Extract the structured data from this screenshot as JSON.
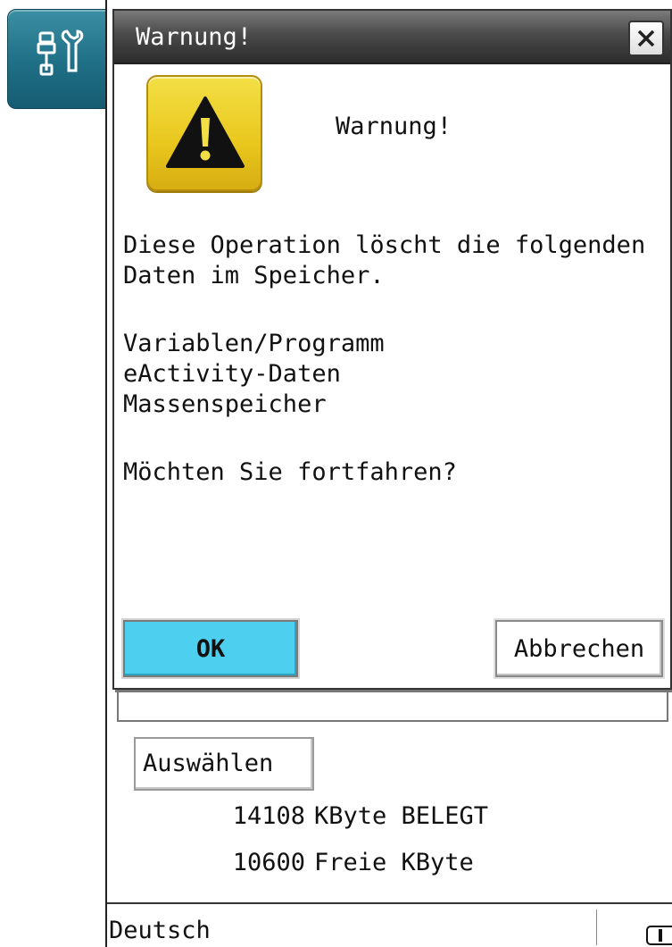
{
  "app": {
    "icon": "settings-tools-icon"
  },
  "dialog": {
    "title": "Warnung!",
    "close_icon": "close-icon",
    "warning_icon": "warning-triangle-icon",
    "heading": "Warnung!",
    "message_lines": [
      "Diese Operation löscht die folgenden",
      "Daten im Speicher."
    ],
    "items": [
      "Variablen/Programm",
      "eActivity-Daten",
      "Massenspeicher"
    ],
    "question": "Möchten Sie fortfahren?",
    "ok_label": "OK",
    "cancel_label": "Abbrechen",
    "ok_color": "#4dd0ef"
  },
  "background": {
    "select_label": "Auswählen",
    "memory": [
      {
        "value": "14108",
        "label": "KByte BELEGT"
      },
      {
        "value": "10600",
        "label": "Freie KByte"
      }
    ]
  },
  "status_bar": {
    "language": "Deutsch",
    "battery_icon": "battery-icon"
  }
}
